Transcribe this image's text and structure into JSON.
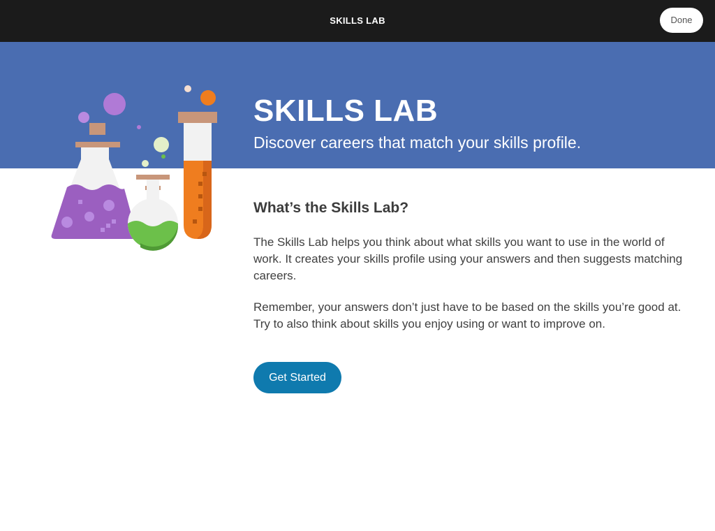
{
  "header": {
    "title": "SKILLS LAB",
    "done_label": "Done"
  },
  "hero": {
    "title": "SKILLS LAB",
    "subtitle": "Discover careers that match your skills profile."
  },
  "illustration": {
    "icon": "lab-flasks-illustration",
    "colors": {
      "purple": "#9b5fc0",
      "green": "#6cc04a",
      "orange": "#ef7d1f",
      "cork": "#c8967a"
    }
  },
  "content": {
    "heading": "What’s the Skills Lab?",
    "paragraph_1": "The Skills Lab helps you think about what skills you want to use in the world of work. It creates your skills profile using your answers and then suggests matching careers.",
    "paragraph_2": "Remember, your answers don’t just have to be based on the skills you’re good at. Try to also think about skills you enjoy using or want to improve on.",
    "cta_label": "Get Started"
  },
  "colors": {
    "topbar": "#1b1b1b",
    "hero": "#4a6db1",
    "button": "#0f7aae"
  }
}
